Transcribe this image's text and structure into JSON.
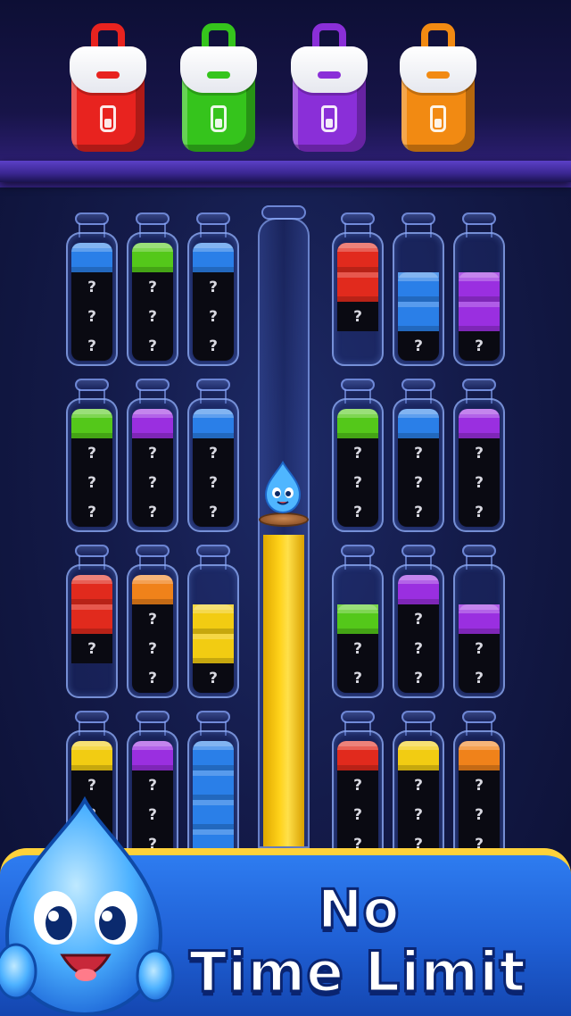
{
  "bags": [
    {
      "color": "#e8231f",
      "name": "red-bag"
    },
    {
      "color": "#35c41c",
      "name": "green-bag"
    },
    {
      "color": "#8a2fd8",
      "name": "purple-bag"
    },
    {
      "color": "#f28a12",
      "name": "orange-bag"
    }
  ],
  "colors": {
    "blue": "#2a7fe8",
    "green": "#54c81a",
    "red": "#e12a1d",
    "purple": "#9a2fe0",
    "orange": "#f0821a",
    "yellow": "#f2cc12"
  },
  "unknown_symbol": "?",
  "tubes": [
    {
      "col": 0,
      "row": 0,
      "layers": [
        "blue",
        "?",
        "?",
        "?"
      ]
    },
    {
      "col": 1,
      "row": 0,
      "layers": [
        "green",
        "?",
        "?",
        "?"
      ]
    },
    {
      "col": 2,
      "row": 0,
      "layers": [
        "blue",
        "?",
        "?",
        "?"
      ]
    },
    {
      "col": 3,
      "row": 0,
      "layers": [
        "red",
        "red",
        "?",
        ""
      ]
    },
    {
      "col": 4,
      "row": 0,
      "layers": [
        "",
        "blue",
        "blue",
        "?"
      ]
    },
    {
      "col": 5,
      "row": 0,
      "layers": [
        "",
        "purple",
        "purple",
        "?"
      ]
    },
    {
      "col": 0,
      "row": 1,
      "layers": [
        "green",
        "?",
        "?",
        "?"
      ]
    },
    {
      "col": 1,
      "row": 1,
      "layers": [
        "purple",
        "?",
        "?",
        "?"
      ]
    },
    {
      "col": 2,
      "row": 1,
      "layers": [
        "blue",
        "?",
        "?",
        "?"
      ]
    },
    {
      "col": 3,
      "row": 1,
      "layers": [
        "green",
        "?",
        "?",
        "?"
      ]
    },
    {
      "col": 4,
      "row": 1,
      "layers": [
        "blue",
        "?",
        "?",
        "?"
      ]
    },
    {
      "col": 5,
      "row": 1,
      "layers": [
        "purple",
        "?",
        "?",
        "?"
      ]
    },
    {
      "col": 0,
      "row": 2,
      "layers": [
        "red",
        "red",
        "?",
        ""
      ]
    },
    {
      "col": 1,
      "row": 2,
      "layers": [
        "orange",
        "?",
        "?",
        "?"
      ]
    },
    {
      "col": 2,
      "row": 2,
      "layers": [
        "",
        "yellow",
        "yellow",
        "?"
      ]
    },
    {
      "col": 3,
      "row": 2,
      "layers": [
        "",
        "green",
        "?",
        "?"
      ]
    },
    {
      "col": 4,
      "row": 2,
      "layers": [
        "purple",
        "?",
        "?",
        "?"
      ]
    },
    {
      "col": 5,
      "row": 2,
      "layers": [
        "",
        "purple",
        "?",
        "?"
      ]
    },
    {
      "col": 0,
      "row": 3,
      "layers": [
        "yellow",
        "?",
        "?",
        "?"
      ]
    },
    {
      "col": 1,
      "row": 3,
      "layers": [
        "purple",
        "?",
        "?",
        "?"
      ]
    },
    {
      "col": 2,
      "row": 3,
      "layers": [
        "blue",
        "blue",
        "blue",
        "blue"
      ]
    },
    {
      "col": 3,
      "row": 3,
      "layers": [
        "red",
        "?",
        "?",
        "?"
      ]
    },
    {
      "col": 4,
      "row": 3,
      "layers": [
        "yellow",
        "?",
        "?",
        "?"
      ]
    },
    {
      "col": 5,
      "row": 3,
      "layers": [
        "orange",
        "?",
        "?",
        "?"
      ]
    }
  ],
  "tall_tube": {
    "fill_color": "yellow",
    "fill_level": 0.5
  },
  "banner": {
    "line1": "No",
    "line2": "Time Limit"
  }
}
